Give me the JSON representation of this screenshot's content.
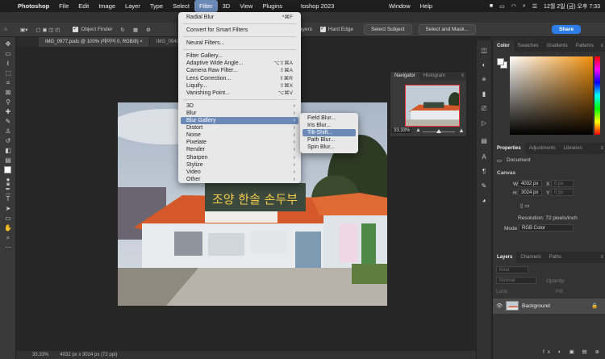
{
  "menubar": {
    "app": "Photoshop",
    "items": [
      "File",
      "Edit",
      "Image",
      "Layer",
      "Type",
      "Select",
      "Filter",
      "3D",
      "View",
      "Plugins"
    ],
    "window": "Window",
    "help": "Help",
    "clock": "12월 2일 (금) 오후 7:33",
    "window_title": "toshop 2023"
  },
  "optbar": {
    "object_finder": "Object Finder",
    "sample_all_layers": "Sample All Layers",
    "hard_edge": "Hard Edge",
    "select_subject": "Select Subject",
    "select_and_mask": "Select and Mask...",
    "share": "Share"
  },
  "tabs": [
    {
      "label": "IMG_0977.psdc @ 100% (레이어 0, RGB/8)",
      "active": true
    },
    {
      "label": "IMG_0940.",
      "active": false
    }
  ],
  "filter_menu": {
    "items": [
      {
        "label": "Radial Blur",
        "shortcut": "^⌘F"
      },
      {
        "sep": true
      },
      {
        "label": "Convert for Smart Filters",
        "shortcut": ""
      },
      {
        "sep": true
      },
      {
        "label": "Neural Filters...",
        "shortcut": ""
      },
      {
        "sep": true
      },
      {
        "label": "Filter Gallery...",
        "shortcut": ""
      },
      {
        "label": "Adaptive Wide Angle...",
        "shortcut": "⌥⇧⌘A"
      },
      {
        "label": "Camera Raw Filter...",
        "shortcut": "⇧⌘A"
      },
      {
        "label": "Lens Correction...",
        "shortcut": "⇧⌘R"
      },
      {
        "label": "Liquify...",
        "shortcut": "⇧⌘X"
      },
      {
        "label": "Vanishing Point...",
        "shortcut": "⌥⌘V"
      },
      {
        "sep": true
      },
      {
        "label": "3D",
        "sub": true
      },
      {
        "label": "Blur",
        "sub": true
      },
      {
        "label": "Blur Gallery",
        "sub": true,
        "highlight": true
      },
      {
        "label": "Distort",
        "sub": true
      },
      {
        "label": "Noise",
        "sub": true
      },
      {
        "label": "Pixelate",
        "sub": true
      },
      {
        "label": "Render",
        "sub": true
      },
      {
        "label": "Sharpen",
        "sub": true
      },
      {
        "label": "Stylize",
        "sub": true
      },
      {
        "label": "Video",
        "sub": true
      },
      {
        "label": "Other",
        "sub": true
      }
    ]
  },
  "blur_gallery_submenu": [
    {
      "label": "Field Blur...",
      "highlight": false
    },
    {
      "label": "Iris Blur...",
      "highlight": false
    },
    {
      "label": "Tilt-Shift...",
      "highlight": true
    },
    {
      "label": "Path Blur...",
      "highlight": false
    },
    {
      "label": "Spin Blur...",
      "highlight": false
    }
  ],
  "navigator": {
    "tabs": [
      "Navigator",
      "Histogram"
    ],
    "zoom": "33.33%"
  },
  "color_panel": {
    "tabs": [
      "Color",
      "Swatches",
      "Gradients",
      "Patterns"
    ]
  },
  "properties_panel": {
    "tabs": [
      "Properties",
      "Adjustments",
      "Libraries"
    ],
    "document": "Document",
    "canvas": "Canvas",
    "w_label": "W",
    "w_value": "4032 px",
    "h_label": "H",
    "h_value": "3024 px",
    "x_label": "X",
    "x_value": "0 px",
    "y_label": "Y",
    "y_value": "0 px",
    "resolution": "Resolution: 72 pixels/inch",
    "mode_label": "Mode",
    "mode_value": "RGB Color"
  },
  "layers_panel": {
    "tabs": [
      "Layers",
      "Channels",
      "Paths"
    ],
    "kind": "Kind",
    "blend": "Normal",
    "opacity": "Opacity:",
    "lock": "Lock:",
    "fill": "Fill:",
    "layer_name": "Background"
  },
  "status": {
    "zoom": "33.33%",
    "size": "4032 px x 3024 px (72 ppi)"
  },
  "colors": {
    "highlight": "#6c8ab8",
    "share": "#2d7de6",
    "accent_orange": "#f2900b"
  }
}
